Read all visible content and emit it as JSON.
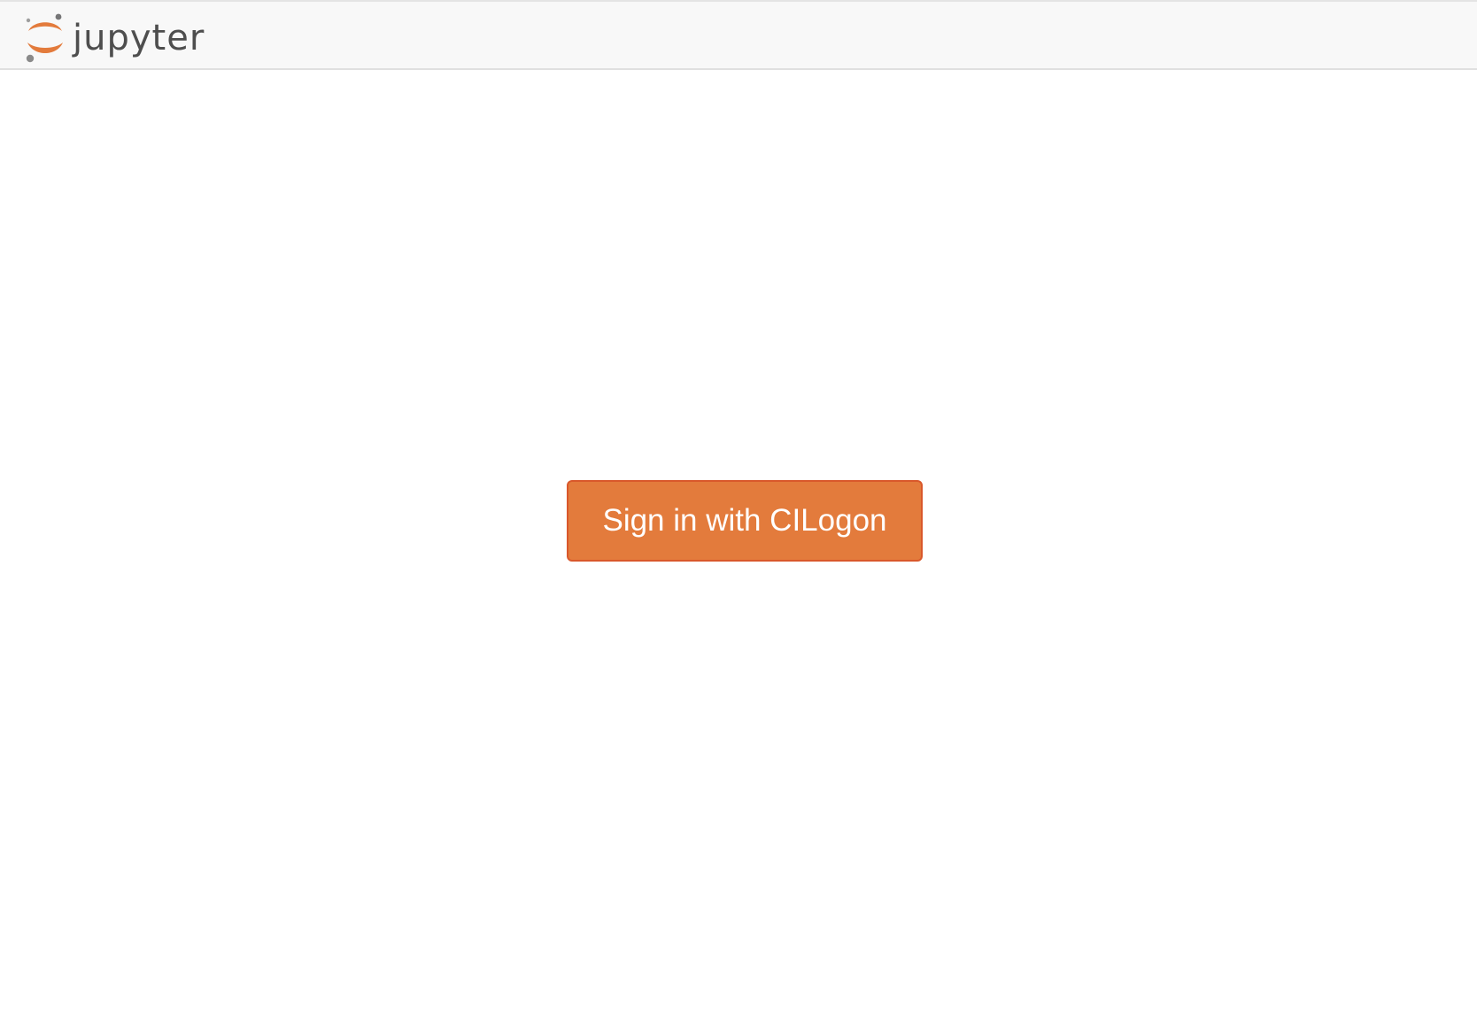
{
  "header": {
    "logo_icon": "jupyter-logo-icon",
    "logo_text": "jupyter",
    "brand_color": "#e37b3c",
    "moon_color": "#767677"
  },
  "login": {
    "button_label": "Sign in with CILogon",
    "button_color": "#e37b3c",
    "button_border_color": "#d9582b"
  }
}
